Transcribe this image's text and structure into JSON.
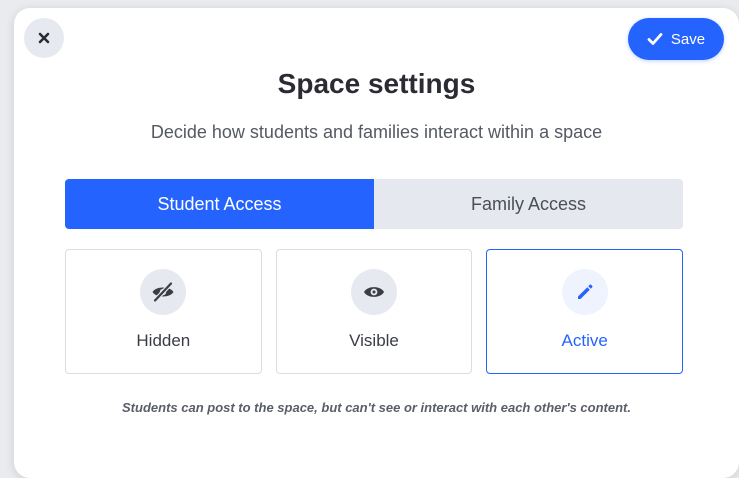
{
  "header": {
    "title": "Space settings",
    "subtitle": "Decide how students and families interact within a space",
    "save_label": "Save"
  },
  "tabs": [
    {
      "label": "Student Access",
      "active": true
    },
    {
      "label": "Family Access",
      "active": false
    }
  ],
  "options": [
    {
      "label": "Hidden",
      "icon": "eye-slash-icon",
      "selected": false
    },
    {
      "label": "Visible",
      "icon": "eye-icon",
      "selected": false
    },
    {
      "label": "Active",
      "icon": "pencil-icon",
      "selected": true
    }
  ],
  "footnote": "Students can post to the space, but can't see or interact with each other's content.",
  "colors": {
    "accent": "#2563ff",
    "tab_inactive": "#e5e8ee",
    "icon_circle": "#e6e9ef",
    "icon_dark": "#3a3d44"
  }
}
